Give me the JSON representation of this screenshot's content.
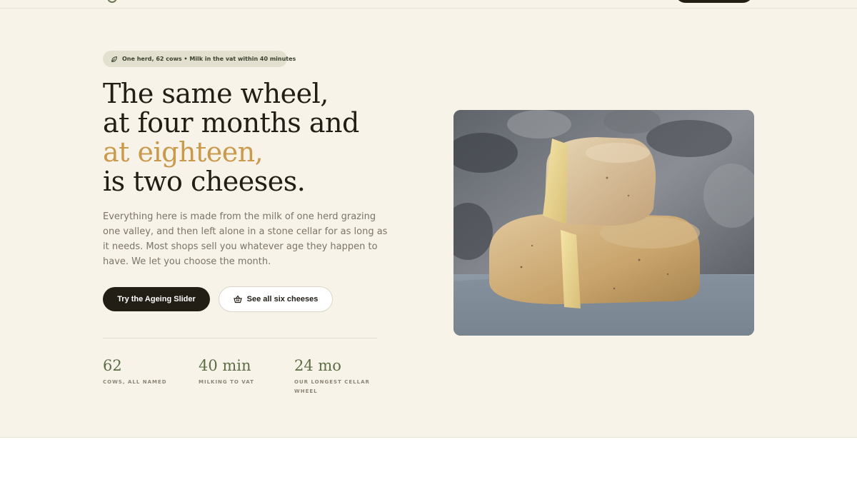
{
  "eyebrow": {
    "icon": "leaf-icon",
    "text": "One herd, 62 cows • Milk in the vat within 40 minutes"
  },
  "headline": {
    "line1": "The same wheel,",
    "line2": "at four months and",
    "line3": "at eighteen,",
    "line4": "is two cheeses."
  },
  "lede": "Everything here is made from the milk of one herd grazing one valley, and then left alone in a stone cellar for as long as it needs. Most shops sell you whatever age they happen to have. We let you choose the month.",
  "buttons": {
    "primary": "Try the Ageing Slider",
    "secondary": "See all six cheeses",
    "secondary_icon": "basket-icon"
  },
  "stats": [
    {
      "value": "62",
      "label": "Cows, all named"
    },
    {
      "value": "40 min",
      "label": "Milking to vat"
    },
    {
      "value": "24 mo",
      "label": "Our longest cellar wheel"
    }
  ],
  "colors": {
    "background": "#f8f3e9",
    "accent": "#c99a4c",
    "dark": "#221d15",
    "green": "#5d6e44"
  }
}
